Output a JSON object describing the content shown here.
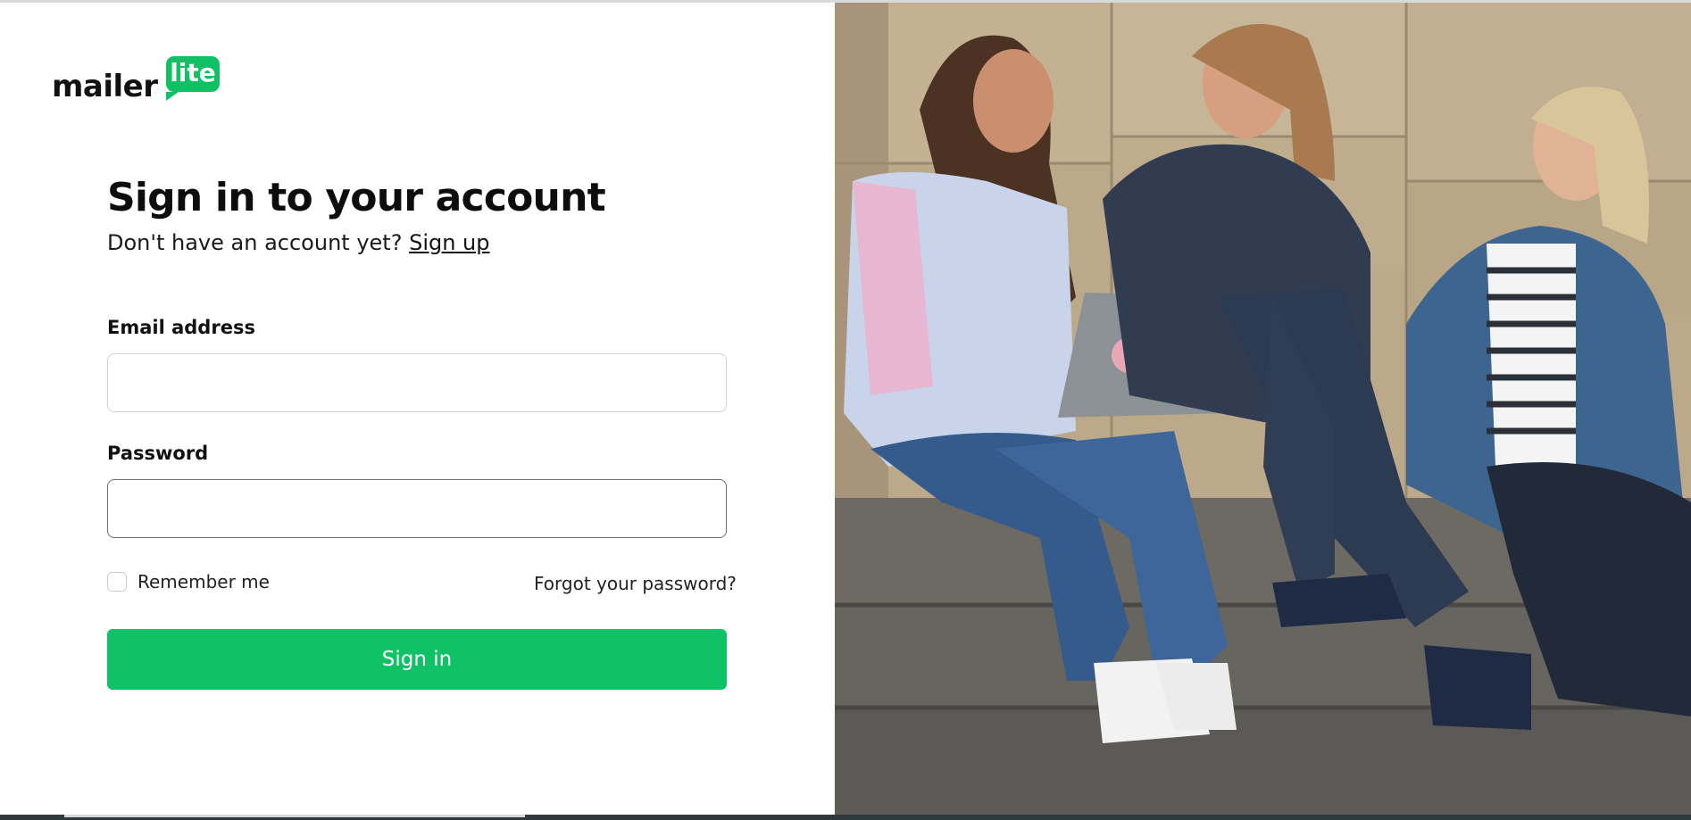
{
  "brand": {
    "logo_word": "mailer",
    "logo_badge": "lite",
    "accent": "#10c065"
  },
  "signin_form": {
    "title": "Sign in to your account",
    "subtitle_text": "Don't have an account yet?",
    "signup_link": "Sign up",
    "email_label": "Email address",
    "email_value": "",
    "password_label": "Password",
    "password_value": "",
    "remember_label": "Remember me",
    "forgot_link": "Forgot your password?",
    "submit_label": "Sign in"
  },
  "hero": {
    "description": "photo-three-women-sitting-on-steps-with-laptop"
  }
}
